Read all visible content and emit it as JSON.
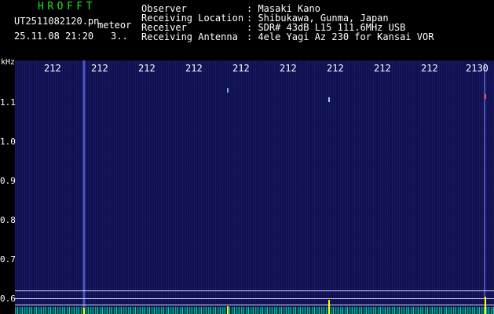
{
  "header": {
    "app_name": "HROFFT",
    "filename": "UT2511082120.pn",
    "software": "meteor",
    "datetime": "25.11.08 21:20",
    "datecode": "3.."
  },
  "info": [
    {
      "label": "Observer",
      "value": ": Masaki Kano"
    },
    {
      "label": "Receiving Location",
      "value": ": Shibukawa, Gunma, Japan"
    },
    {
      "label": "Receiver",
      "value": ": SDR# 43dB L15 111.6MHz USB"
    },
    {
      "label": "Receiving Antenna",
      "value": ": 4ele Yagi Az 230 for Kansai VOR"
    }
  ],
  "axis": {
    "unit": "kHz",
    "time_ticks": [
      "212",
      "212",
      "212",
      "212",
      "212",
      "212",
      "212",
      "212",
      "212",
      "2130"
    ],
    "freq_ticks": [
      "1.1",
      "1.0",
      "0.9",
      "0.8",
      "0.7",
      "0.6"
    ]
  },
  "colors": {
    "title_green": "#19e619",
    "background": "#10104a",
    "spectrum": "#00cccc",
    "spike": "#ffff00"
  }
}
